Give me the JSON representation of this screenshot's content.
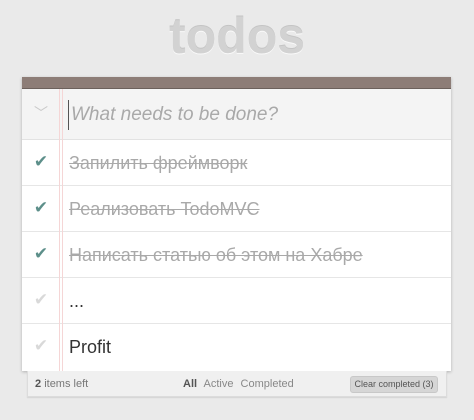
{
  "app": {
    "title": "todos"
  },
  "header": {
    "toggle_all_icon": "chevron-down-double-icon",
    "new_todo_placeholder": "What needs to be done?",
    "new_todo_value": ""
  },
  "todos": [
    {
      "label": "Запилить фреймворк",
      "completed": true
    },
    {
      "label": "Реализовать TodoMVC",
      "completed": true
    },
    {
      "label": "Написать статью об этом на Хабре",
      "completed": true
    },
    {
      "label": "...",
      "completed": false
    },
    {
      "label": "Profit",
      "completed": false
    }
  ],
  "footer": {
    "count": "2",
    "count_suffix": "items left",
    "filters": [
      "All",
      "Active",
      "Completed"
    ],
    "selected_filter": "All",
    "clear_completed_label": "Clear completed (3)"
  },
  "colors": {
    "accent_bar": "#8d7d77",
    "check_done": "#5d8f8a",
    "check_undone": "#d9d9d9",
    "title": "#d2d2d2"
  }
}
